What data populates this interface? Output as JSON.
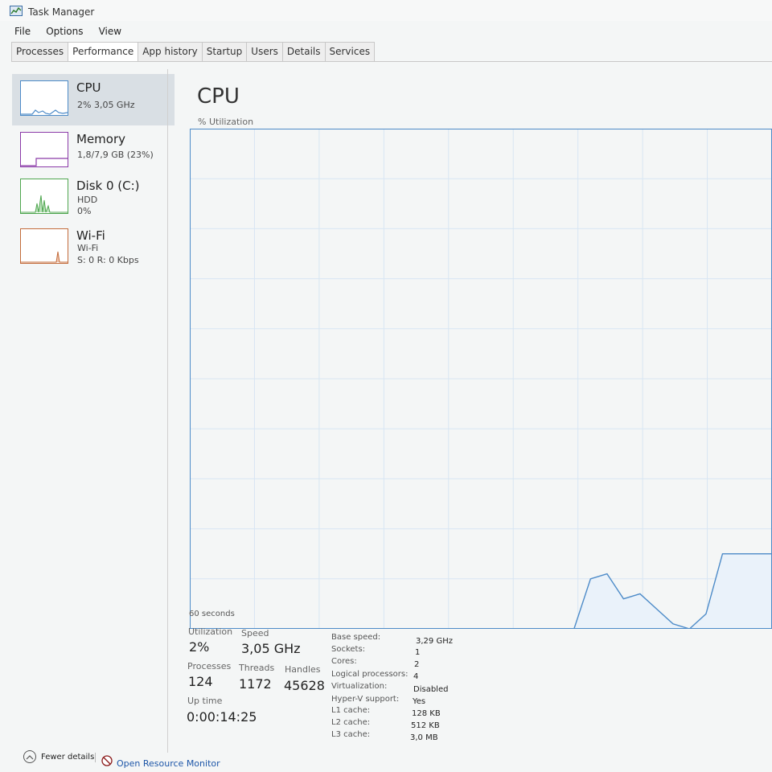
{
  "window": {
    "title": "Task Manager"
  },
  "menu": [
    "File",
    "Options",
    "View"
  ],
  "tabs": [
    "Processes",
    "Performance",
    "App history",
    "Startup",
    "Users",
    "Details",
    "Services"
  ],
  "active_tab": "Performance",
  "sidebar": [
    {
      "name": "CPU",
      "sub1": "2% 3,05 GHz",
      "sub2": "",
      "sub3": "",
      "selected": true,
      "color": "#4d8bc8"
    },
    {
      "name": "Memory",
      "sub1": "1,8/7,9 GB (23%)",
      "sub2": "",
      "sub3": "",
      "selected": false,
      "color": "#8b3aa8"
    },
    {
      "name": "Disk 0 (C:)",
      "sub1": "HDD",
      "sub2": "0%",
      "sub3": "",
      "selected": false,
      "color": "#4fa64f"
    },
    {
      "name": "Wi-Fi",
      "sub1": "Wi-Fi",
      "sub2": "S: 0 R: 0 Kbps",
      "sub3": "",
      "selected": false,
      "color": "#c36b3a"
    }
  ],
  "main": {
    "title": "CPU",
    "util_label": "% Utilization",
    "seconds_label": "60 seconds"
  },
  "stats": {
    "utilization_label": "Utilization",
    "utilization": "2%",
    "speed_label": "Speed",
    "speed": "3,05 GHz",
    "processes_label": "Processes",
    "processes": "124",
    "threads_label": "Threads",
    "threads": "1172",
    "handles_label": "Handles",
    "handles": "45628",
    "uptime_label": "Up time",
    "uptime": "0:00:14:25"
  },
  "specs": [
    {
      "label": "Base speed:",
      "value": "3,29 GHz"
    },
    {
      "label": "Sockets:",
      "value": "1"
    },
    {
      "label": "Cores:",
      "value": "2"
    },
    {
      "label": "Logical processors:",
      "value": "4"
    },
    {
      "label": "Virtualization:",
      "value": "Disabled"
    },
    {
      "label": "Hyper-V support:",
      "value": "Yes"
    },
    {
      "label": "L1 cache:",
      "value": "128 KB"
    },
    {
      "label": "L2 cache:",
      "value": "512 KB"
    },
    {
      "label": "L3 cache:",
      "value": "3,0 MB"
    }
  ],
  "footer": {
    "fewer_details": "Fewer details",
    "resource_monitor": "Open Resource Monitor"
  },
  "colors": {
    "cpu_line": "#4d8bc8",
    "cpu_fill": "#eaf2fa",
    "grid": "#d8e6f3"
  },
  "chart_data": {
    "type": "area",
    "x": [
      0,
      1,
      2,
      3,
      4,
      5,
      6,
      7,
      8,
      9,
      10,
      11,
      12
    ],
    "values": [
      0,
      10,
      11,
      6,
      7,
      4,
      1,
      0,
      3,
      15,
      15,
      15,
      15
    ],
    "ylim": [
      0,
      100
    ]
  }
}
